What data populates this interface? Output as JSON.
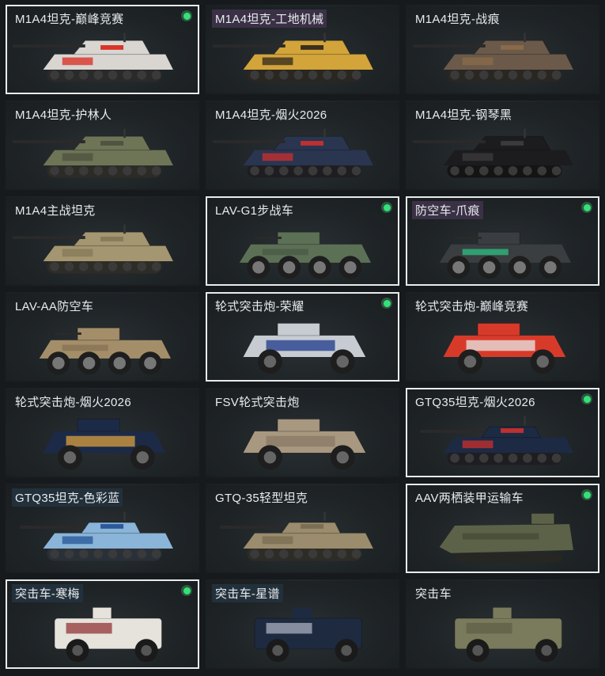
{
  "vehicles": [
    {
      "name": "M1A4坦克-巅峰竞赛",
      "kind": "tank",
      "body": "#d9d6d2",
      "accent": "#d8342a",
      "track": "#2a2a2a",
      "selected": true,
      "equipped": true,
      "label_style": "plain"
    },
    {
      "name": "M1A4坦克-工地机械",
      "kind": "tank",
      "body": "#d2a43a",
      "accent": "#3a2e1e",
      "track": "#2a2620",
      "selected": false,
      "equipped": false,
      "label_style": "hl"
    },
    {
      "name": "M1A4坦克-战痕",
      "kind": "tank",
      "body": "#6b5a4a",
      "accent": "#8a6a4a",
      "track": "#2a2622",
      "selected": false,
      "equipped": false,
      "label_style": "plain"
    },
    {
      "name": "M1A4坦克-护林人",
      "kind": "tank",
      "body": "#6e7456",
      "accent": "#4e5440",
      "track": "#2c2c26",
      "selected": false,
      "equipped": false,
      "label_style": "plain"
    },
    {
      "name": "M1A4坦克-烟火2026",
      "kind": "tank",
      "body": "#2a3550",
      "accent": "#c03030",
      "track": "#1e1e22",
      "selected": false,
      "equipped": false,
      "label_style": "plain"
    },
    {
      "name": "M1A4坦克-钢琴黑",
      "kind": "tank",
      "body": "#1c1c1e",
      "accent": "#3a3a3c",
      "track": "#141414",
      "selected": false,
      "equipped": false,
      "label_style": "plain"
    },
    {
      "name": "M1A4主战坦克",
      "kind": "tank",
      "body": "#a49670",
      "accent": "#867a5a",
      "track": "#2e2c26",
      "selected": false,
      "equipped": false,
      "label_style": "plain"
    },
    {
      "name": "LAV-G1步战车",
      "kind": "apc",
      "body": "#5c7056",
      "accent": "#4a5a46",
      "track": "#222",
      "selected": true,
      "equipped": true,
      "label_style": "plain"
    },
    {
      "name": "防空车-爪痕",
      "kind": "apc",
      "body": "#3a3e40",
      "accent": "#2fb07a",
      "track": "#222",
      "selected": true,
      "equipped": true,
      "label_style": "hl"
    },
    {
      "name": "LAV-AA防空车",
      "kind": "apc",
      "body": "#a48e6a",
      "accent": "#8a7656",
      "track": "#222",
      "selected": false,
      "equipped": false,
      "label_style": "plain"
    },
    {
      "name": "轮式突击炮-荣耀",
      "kind": "truck",
      "body": "#c7ccd2",
      "accent": "#1e3a8a",
      "track": "#222",
      "selected": true,
      "equipped": true,
      "label_style": "plain"
    },
    {
      "name": "轮式突击炮-巅峰竞赛",
      "kind": "truck",
      "body": "#d83a2a",
      "accent": "#e8e8e8",
      "track": "#222",
      "selected": false,
      "equipped": false,
      "label_style": "plain"
    },
    {
      "name": "轮式突击炮-烟火2026",
      "kind": "truck",
      "body": "#1c2a48",
      "accent": "#d8a040",
      "track": "#222",
      "selected": false,
      "equipped": false,
      "label_style": "plain"
    },
    {
      "name": "FSV轮式突击炮",
      "kind": "truck",
      "body": "#a89880",
      "accent": "#8a7a66",
      "track": "#222",
      "selected": false,
      "equipped": false,
      "label_style": "plain"
    },
    {
      "name": "GTQ35坦克-烟火2026",
      "kind": "light",
      "body": "#1c2a44",
      "accent": "#c03030",
      "track": "#1e1e22",
      "selected": true,
      "equipped": true,
      "label_style": "plain"
    },
    {
      "name": "GTQ35坦克-色彩蓝",
      "kind": "light",
      "body": "#8ab4d8",
      "accent": "#2a5a9a",
      "track": "#2a3038",
      "selected": false,
      "equipped": false,
      "label_style": "blue"
    },
    {
      "name": "GTQ-35轻型坦克",
      "kind": "light",
      "body": "#9a8c6c",
      "accent": "#7a6e54",
      "track": "#2e2c26",
      "selected": false,
      "equipped": false,
      "label_style": "plain"
    },
    {
      "name": "AAV两栖装甲运输车",
      "kind": "aav",
      "body": "#5c6248",
      "accent": "#4a503a",
      "track": "#262622",
      "selected": true,
      "equipped": true,
      "label_style": "plain"
    },
    {
      "name": "突击车-寒梅",
      "kind": "mrap",
      "body": "#e6e2dc",
      "accent": "#8a2a2a",
      "track": "#1c1c1c",
      "selected": true,
      "equipped": true,
      "label_style": "blue"
    },
    {
      "name": "突击车-星谱",
      "kind": "mrap",
      "body": "#1e2a40",
      "accent": "#b0b8c8",
      "track": "#1c1c1c",
      "selected": false,
      "equipped": false,
      "label_style": "blue"
    },
    {
      "name": "突击车",
      "kind": "mrap",
      "body": "#7a7a5c",
      "accent": "#5e5e46",
      "track": "#1c1c1c",
      "selected": false,
      "equipped": false,
      "label_style": "plain"
    }
  ]
}
